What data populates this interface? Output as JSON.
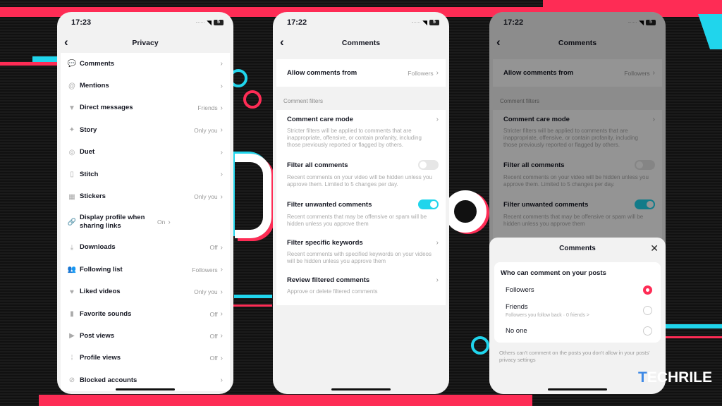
{
  "phones": [
    {
      "status": {
        "time": "17:23",
        "battery": "5"
      },
      "title": "Privacy",
      "items": [
        {
          "icon": "comment-icon",
          "glyph": "💬",
          "label": "Comments",
          "value": ""
        },
        {
          "icon": "at-icon",
          "glyph": "@",
          "label": "Mentions",
          "value": ""
        },
        {
          "icon": "send-icon",
          "glyph": "▼",
          "label": "Direct messages",
          "value": "Friends"
        },
        {
          "icon": "sparkle-icon",
          "glyph": "✦",
          "label": "Story",
          "value": "Only you"
        },
        {
          "icon": "duet-icon",
          "glyph": "◎",
          "label": "Duet",
          "value": ""
        },
        {
          "icon": "stitch-icon",
          "glyph": "▯",
          "label": "Stitch",
          "value": ""
        },
        {
          "icon": "sticker-icon",
          "glyph": "▦",
          "label": "Stickers",
          "value": "Only you"
        },
        {
          "icon": "link-icon",
          "glyph": "🔗",
          "label": "Display profile when sharing links",
          "value": "On"
        },
        {
          "icon": "download-icon",
          "glyph": "⤓",
          "label": "Downloads",
          "value": "Off"
        },
        {
          "icon": "people-icon",
          "glyph": "👥",
          "label": "Following list",
          "value": "Followers"
        },
        {
          "icon": "heart-icon",
          "glyph": "♥",
          "label": "Liked videos",
          "value": "Only you"
        },
        {
          "icon": "bookmark-icon",
          "glyph": "▮",
          "label": "Favorite sounds",
          "value": "Off"
        },
        {
          "icon": "play-icon",
          "glyph": "▶",
          "label": "Post views",
          "value": "Off"
        },
        {
          "icon": "footprint-icon",
          "glyph": "⁞",
          "label": "Profile views",
          "value": "Off"
        },
        {
          "icon": "block-icon",
          "glyph": "⊘",
          "label": "Blocked accounts",
          "value": ""
        }
      ]
    },
    {
      "status": {
        "time": "17:22",
        "battery": "5"
      },
      "title": "Comments",
      "allow": {
        "label": "Allow comments from",
        "value": "Followers"
      },
      "section": "Comment filters",
      "filters": [
        {
          "title": "Comment care mode",
          "desc": "Stricter filters will be applied to comments that are inappropriate, offensive, or contain profanity, including those previously reported or flagged by others.",
          "control": "chevron"
        },
        {
          "title": "Filter all comments",
          "desc": "Recent comments on your video will be hidden unless you approve them. Limited to 5 changes per day.",
          "control": "toggle",
          "on": false
        },
        {
          "title": "Filter unwanted comments",
          "desc": "Recent comments that may be offensive or spam will be hidden unless you approve them",
          "control": "toggle",
          "on": true
        },
        {
          "title": "Filter specific keywords",
          "desc": "Recent comments with specified keywords on your videos will be hidden unless you approve them",
          "control": "chevron"
        },
        {
          "title": "Review filtered comments",
          "desc": "Approve or delete filtered comments",
          "control": "chevron"
        }
      ]
    },
    {
      "status": {
        "time": "17:22",
        "battery": "5"
      },
      "title": "Comments",
      "sheet": {
        "title": "Comments",
        "question": "Who can comment on your posts",
        "options": [
          {
            "label": "Followers",
            "sub": "",
            "selected": true
          },
          {
            "label": "Friends",
            "sub": "Followers you follow back · 0 friends >",
            "selected": false
          },
          {
            "label": "No one",
            "sub": "",
            "selected": false
          }
        ],
        "note": "Others can't comment on the posts you don't allow in your posts' privacy settings"
      }
    }
  ],
  "watermark": {
    "t": "T",
    "rest": "ECHRILE"
  },
  "colors": {
    "accent_red": "#fe2c55",
    "accent_cyan": "#20d5ec"
  }
}
